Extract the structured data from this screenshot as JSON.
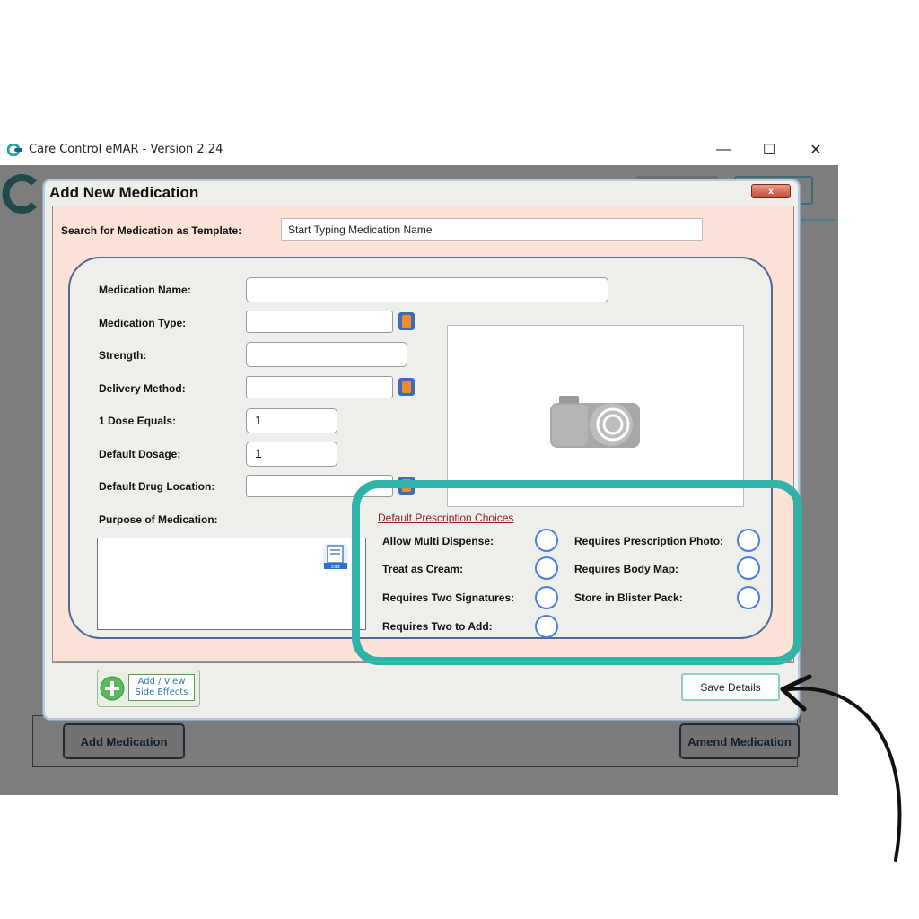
{
  "window": {
    "title": "Care Control eMAR - Version 2.24",
    "controls": {
      "minimize": "—",
      "maximize": "☐",
      "close": "✕"
    }
  },
  "background_buttons": {
    "add_medication": "Add Medication",
    "amend_medication": "Amend Medication"
  },
  "dialog": {
    "title": "Add New Medication",
    "close_glyph": "x",
    "search": {
      "label": "Search for Medication as Template:",
      "value": "Start Typing Medication Name"
    },
    "fields": {
      "medication_name": {
        "label": "Medication Name:",
        "value": ""
      },
      "medication_type": {
        "label": "Medication Type:",
        "value": ""
      },
      "strength": {
        "label": "Strength:",
        "value": ""
      },
      "delivery_method": {
        "label": "Delivery Method:",
        "value": ""
      },
      "dose_equals": {
        "label": "1 Dose Equals:",
        "value": "1"
      },
      "default_dosage": {
        "label": "Default Dosage:",
        "value": "1"
      },
      "drug_location": {
        "label": "Default Drug Location:",
        "value": ""
      },
      "purpose": {
        "label": "Purpose of Medication:",
        "value": ""
      }
    },
    "edit_icon_text": "Edit",
    "prescription_choices": {
      "title": "Default Prescription Choices",
      "allow_multi_dispense": "Allow Multi Dispense:",
      "treat_as_cream": "Treat as Cream:",
      "requires_two_signatures": "Requires Two Signatures:",
      "requires_two_to_add": "Requires Two to Add:",
      "requires_prescription_photo": "Requires Prescription Photo:",
      "requires_body_map": "Requires Body Map:",
      "store_in_blister_pack": "Store in Blister Pack:"
    },
    "side_effects_button": {
      "line1": "Add / View",
      "line2": "Side Effects"
    },
    "save_button": "Save Details"
  },
  "colors": {
    "highlight": "#2fb3a8",
    "peach_panel": "#fde3d7",
    "radio_border": "#4a7fe0",
    "dropdown_button": "#3d6db0",
    "dropdown_arrow": "#f08c2e"
  },
  "icons": [
    "care-control-logo-icon",
    "camera-icon",
    "edit-icon",
    "plus-icon",
    "dropdown-arrow-icon",
    "annotation-arrow-icon"
  ]
}
